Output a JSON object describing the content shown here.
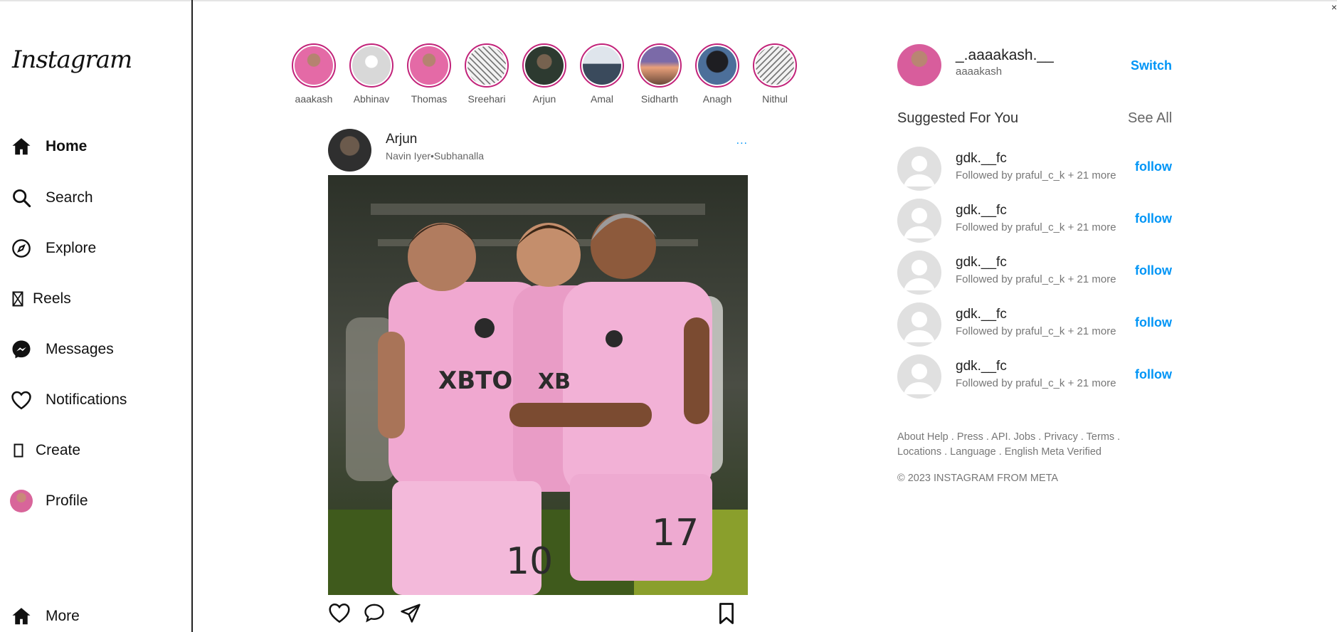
{
  "app": {
    "title": "Instagram"
  },
  "sidebar": {
    "items": [
      {
        "label": "Home",
        "icon": "home-icon",
        "active": true
      },
      {
        "label": "Search",
        "icon": "search-icon"
      },
      {
        "label": "Explore",
        "icon": "compass-icon"
      },
      {
        "label": "Reels",
        "icon": "reels-icon"
      },
      {
        "label": "Messages",
        "icon": "messenger-icon"
      },
      {
        "label": "Notifications",
        "icon": "heart-icon"
      },
      {
        "label": "Create",
        "icon": "create-icon"
      },
      {
        "label": "Profile",
        "icon": "profile-avatar"
      }
    ],
    "more_label": "More"
  },
  "stories": [
    {
      "name": "aaakash"
    },
    {
      "name": "Abhinav"
    },
    {
      "name": "Thomas"
    },
    {
      "name": "Sreehari"
    },
    {
      "name": "Arjun"
    },
    {
      "name": "Amal"
    },
    {
      "name": "Sidharth"
    },
    {
      "name": "Anagh"
    },
    {
      "name": "Nithul"
    }
  ],
  "post": {
    "username": "Arjun",
    "location": "Navin Iyer•Subhanalla",
    "more": "...",
    "actions": [
      "like-icon",
      "comment-icon",
      "share-icon",
      "save-icon"
    ]
  },
  "current_user": {
    "username": "_.aaaakash.__",
    "name": "aaaakash",
    "switch_label": "Switch"
  },
  "suggestions": {
    "title": "Suggested For You",
    "see_all": "See All",
    "items": [
      {
        "username": "gdk.__fc",
        "subtitle": "Followed by praful_c_k + 21 more",
        "action": "follow"
      },
      {
        "username": "gdk.__fc",
        "subtitle": "Followed by praful_c_k + 21 more",
        "action": "follow"
      },
      {
        "username": "gdk.__fc",
        "subtitle": "Followed by praful_c_k + 21 more",
        "action": "follow"
      },
      {
        "username": "gdk.__fc",
        "subtitle": "Followed by praful_c_k + 21 more",
        "action": "follow"
      },
      {
        "username": "gdk.__fc",
        "subtitle": "Followed by praful_c_k + 21 more",
        "action": "follow"
      }
    ]
  },
  "footer": {
    "links": "About Help . Press . API. Jobs . Privacy . Terms . Locations . Language . English Meta Verified",
    "copyright": "© 2023 INSTAGRAM FROM META"
  },
  "colors": {
    "accent": "#0095f6",
    "story_ring": "#c2237a"
  }
}
